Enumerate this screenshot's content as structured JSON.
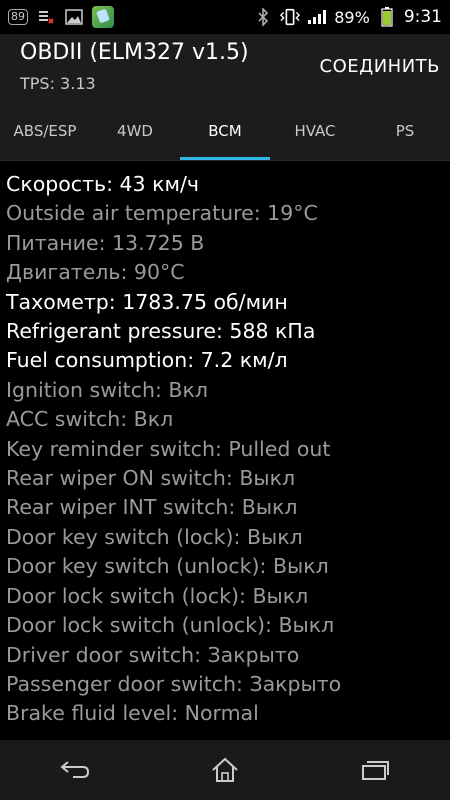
{
  "status_bar": {
    "badge": "89",
    "battery_percent": "89%",
    "time": "9:31",
    "icons": [
      "screenshot-icon",
      "notification-icon",
      "image-icon",
      "app-thumb-icon",
      "bluetooth-icon",
      "vibrate-icon",
      "signal-icon",
      "battery-icon"
    ]
  },
  "app_bar": {
    "title": "OBDII (ELM327 v1.5)",
    "subtitle": "TPS: 3.13",
    "connect_label": "СОЕДИНИТЬ"
  },
  "tabs": [
    {
      "label": "ABS/ESP",
      "active": false
    },
    {
      "label": "4WD",
      "active": false
    },
    {
      "label": "BCM",
      "active": true
    },
    {
      "label": "HVAC",
      "active": false
    },
    {
      "label": "PS",
      "active": false
    }
  ],
  "colors": {
    "accent": "#33b5e5",
    "bright_text": "#ffffff",
    "dim_text": "#9a9a9a"
  },
  "rows": [
    {
      "text": "Скорость: 43 км/ч",
      "bright": true
    },
    {
      "text": "Outside air temperature: 19°C",
      "bright": false
    },
    {
      "text": "Питание: 13.725 В",
      "bright": false
    },
    {
      "text": "Двигатель: 90°C",
      "bright": false
    },
    {
      "text": "Тахометр: 1783.75 об/мин",
      "bright": true
    },
    {
      "text": "Refrigerant pressure: 588 кПа",
      "bright": true
    },
    {
      "text": "Fuel consumption: 7.2 км/л",
      "bright": true
    },
    {
      "text": "Ignition switch: Вкл",
      "bright": false
    },
    {
      "text": "ACC switch: Вкл",
      "bright": false
    },
    {
      "text": "Key reminder switch: Pulled out",
      "bright": false
    },
    {
      "text": "Rear wiper ON switch: Выкл",
      "bright": false
    },
    {
      "text": "Rear wiper INT switch: Выкл",
      "bright": false
    },
    {
      "text": "Door key switch (lock): Выкл",
      "bright": false
    },
    {
      "text": "Door key switch (unlock): Выкл",
      "bright": false
    },
    {
      "text": "Door lock switch (lock): Выкл",
      "bright": false
    },
    {
      "text": "Door lock switch (unlock): Выкл",
      "bright": false
    },
    {
      "text": "Driver door switch: Закрыто",
      "bright": false
    },
    {
      "text": "Passenger door switch: Закрыто",
      "bright": false
    },
    {
      "text": "Brake fluid level: Normal",
      "bright": false
    }
  ],
  "nav": [
    "back-icon",
    "home-icon",
    "recent-apps-icon"
  ]
}
